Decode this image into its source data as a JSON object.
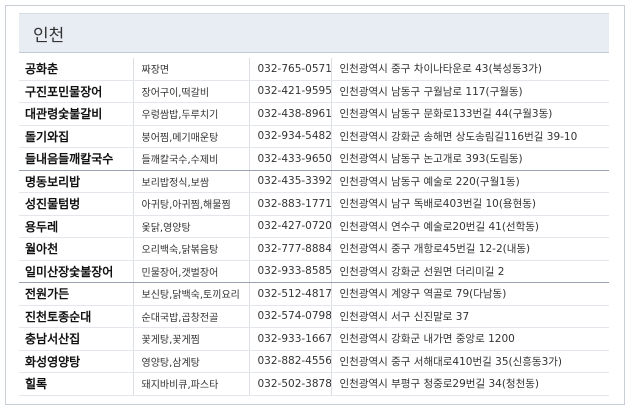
{
  "region": {
    "title": "인천"
  },
  "restaurants": [
    {
      "name": "공화춘",
      "menu": "짜장면",
      "phone": "032-765-0571",
      "address": "인천광역시 중구 차이나타운로 43(북성동3가)"
    },
    {
      "name": "구진포민물장어",
      "menu": "장어구이,떡갈비",
      "phone": "032-421-9595",
      "address": "인천광역시 남동구 구월남로 117(구월동)"
    },
    {
      "name": "대관령숯불갈비",
      "menu": "우렁쌈밥,두루치기",
      "phone": "032-438-8961",
      "address": "인천광역시 남동구 문화로133번길 44(구월3동)"
    },
    {
      "name": "돌기와집",
      "menu": "붕어찜,메기매운탕",
      "phone": "032-934-5482",
      "address": "인천광역시 강화군 송해면 상도송림길116번길 39-10"
    },
    {
      "name": "들내음들깨칼국수",
      "menu": "들깨칼국수,수제비",
      "phone": "032-433-9650",
      "address": "인천광역시 남동구 논고개로 393(도림동)"
    },
    {
      "name": "명동보리밥",
      "menu": "보리밥정식,보쌈",
      "phone": "032-435-3392",
      "address": "인천광역시 남동구 예술로 220(구월1동)"
    },
    {
      "name": "성진물텀벙",
      "menu": "아귀탕,아귀찜,해물찜",
      "phone": "032-883-1771",
      "address": "인천광역시 남구 독배로403번길 10(용현동)"
    },
    {
      "name": "용두레",
      "menu": "옻닭,영양탕",
      "phone": "032-427-0720",
      "address": "인천광역시 연수구 예술로20번길 41(선학동)"
    },
    {
      "name": "월아천",
      "menu": "오리백숙,닭볶음탕",
      "phone": "032-777-8884",
      "address": "인천광역시 중구 개항로45번길 12-2(내동)"
    },
    {
      "name": "일미산장숯불장어",
      "menu": "민물장어,갯벌장어",
      "phone": "032-933-8585",
      "address": "인천광역시 강화군 선원면 더리미길 2"
    },
    {
      "name": "전원가든",
      "menu": "보신탕,닭백숙,토끼요리",
      "phone": "032-512-4817",
      "address": "인천광역시 계양구 역골로 79(다남동)"
    },
    {
      "name": "진천토종순대",
      "menu": "순대국밥,곱창전골",
      "phone": "032-574-0798",
      "address": "인천광역시 서구 신진말로 37"
    },
    {
      "name": "충남서산집",
      "menu": "꽃게탕,꽃게찜",
      "phone": "032-933-1667",
      "address": "인천광역시 강화군 내가면 중앙로 1200"
    },
    {
      "name": "화성영양탕",
      "menu": "영양탕,삼계탕",
      "phone": "032-882-4556",
      "address": "인천광역시 중구 서해대로410번길 35(신흥동3가)"
    },
    {
      "name": "힐록",
      "menu": "돼지바비큐,파스타",
      "phone": "032-502-3878",
      "address": "인천광역시 부평구 청중로29번길 34(청천동)"
    }
  ]
}
